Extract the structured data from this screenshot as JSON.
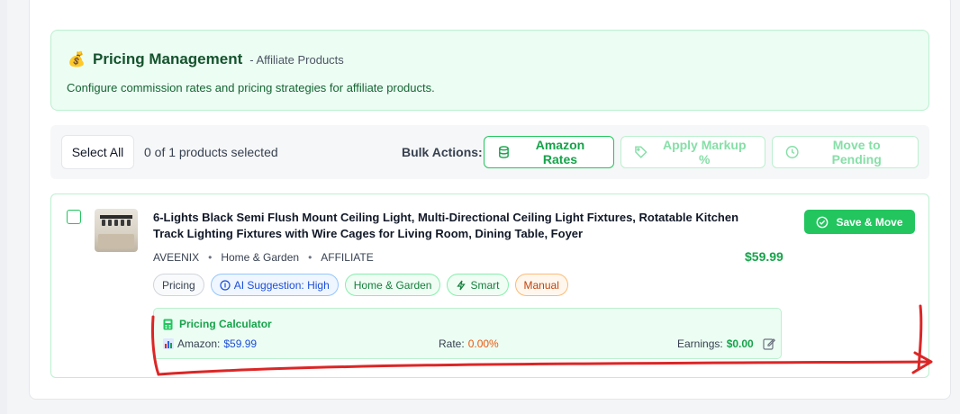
{
  "header": {
    "icon": "money-bag-icon",
    "title": "Pricing Management",
    "subtitle": "- Affiliate Products",
    "description": "Configure commission rates and pricing strategies for affiliate products."
  },
  "bulk": {
    "select_all_label": "Select All",
    "selection_status": "0 of 1 products selected",
    "actions_label": "Bulk Actions:",
    "amazon_rates_label": "Amazon Rates",
    "apply_markup_label": "Apply Markup %",
    "move_pending_label": "Move to Pending"
  },
  "product": {
    "title": "6-Lights Black Semi Flush Mount Ceiling Light, Multi-Directional Ceiling Light Fixtures, Rotatable Kitchen Track Lighting Fixtures with Wire Cages for Living Room, Dining Table, Foyer",
    "brand": "AVEENIX",
    "category": "Home & Garden",
    "type": "AFFILIATE",
    "price": "$59.99",
    "save_label": "Save & Move",
    "tags": {
      "pricing": "Pricing",
      "ai": "AI Suggestion: High",
      "home": "Home & Garden",
      "smart": "Smart",
      "manual": "Manual"
    },
    "calculator": {
      "title": "Pricing Calculator",
      "amazon_label": "Amazon:",
      "amazon_value": "$59.99",
      "rate_label": "Rate:",
      "rate_value": "0.00%",
      "earnings_label": "Earnings:",
      "earnings_value": "$0.00"
    }
  },
  "colors": {
    "accent": "#22c55e",
    "annotation": "#dc2626"
  }
}
